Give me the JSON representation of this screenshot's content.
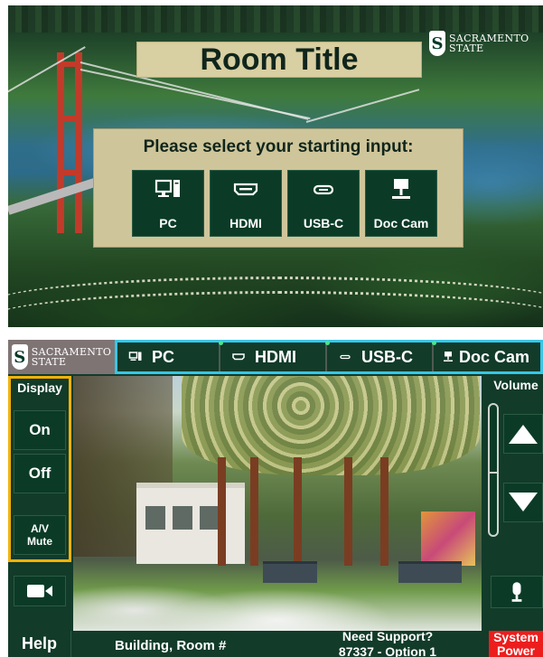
{
  "top_panel": {
    "brand": {
      "line1": "SACRAMENTO",
      "line2": "STATE",
      "mark": "S"
    },
    "room_title": "Room Title",
    "prompt": "Please select your starting input:",
    "inputs": [
      {
        "label": "PC",
        "icon": "pc-icon"
      },
      {
        "label": "HDMI",
        "icon": "hdmi-icon"
      },
      {
        "label": "USB-C",
        "icon": "usb-c-icon"
      },
      {
        "label": "Doc Cam",
        "icon": "doc-cam-icon"
      }
    ]
  },
  "bottom_panel": {
    "brand": {
      "line1": "SACRAMENTO",
      "line2": "STATE",
      "mark": "S"
    },
    "source_tabs": [
      {
        "label": "PC",
        "icon": "pc-icon"
      },
      {
        "label": "HDMI",
        "icon": "hdmi-icon"
      },
      {
        "label": "USB-C",
        "icon": "usb-c-icon"
      },
      {
        "label": "Doc Cam",
        "icon": "doc-cam-icon"
      }
    ],
    "display": {
      "label": "Display",
      "on_label": "On",
      "off_label": "Off",
      "av_mute_line1": "A/V",
      "av_mute_line2": "Mute"
    },
    "volume": {
      "label": "Volume",
      "level": 0.4
    },
    "footer": {
      "help_label": "Help",
      "location": "Building, Room #",
      "support_line1": "Need Support?",
      "support_line2": "87337 - Option 1",
      "power_line1": "System",
      "power_line2": "Power"
    }
  },
  "colors": {
    "sac_green": "#043927",
    "panel_green": "#123b2a",
    "gold": "#d8cfa2",
    "highlight_orange": "#f2b20a",
    "highlight_cyan": "#38c6e6",
    "power_red": "#ee1d1d",
    "active_dot": "#4ce38b"
  }
}
